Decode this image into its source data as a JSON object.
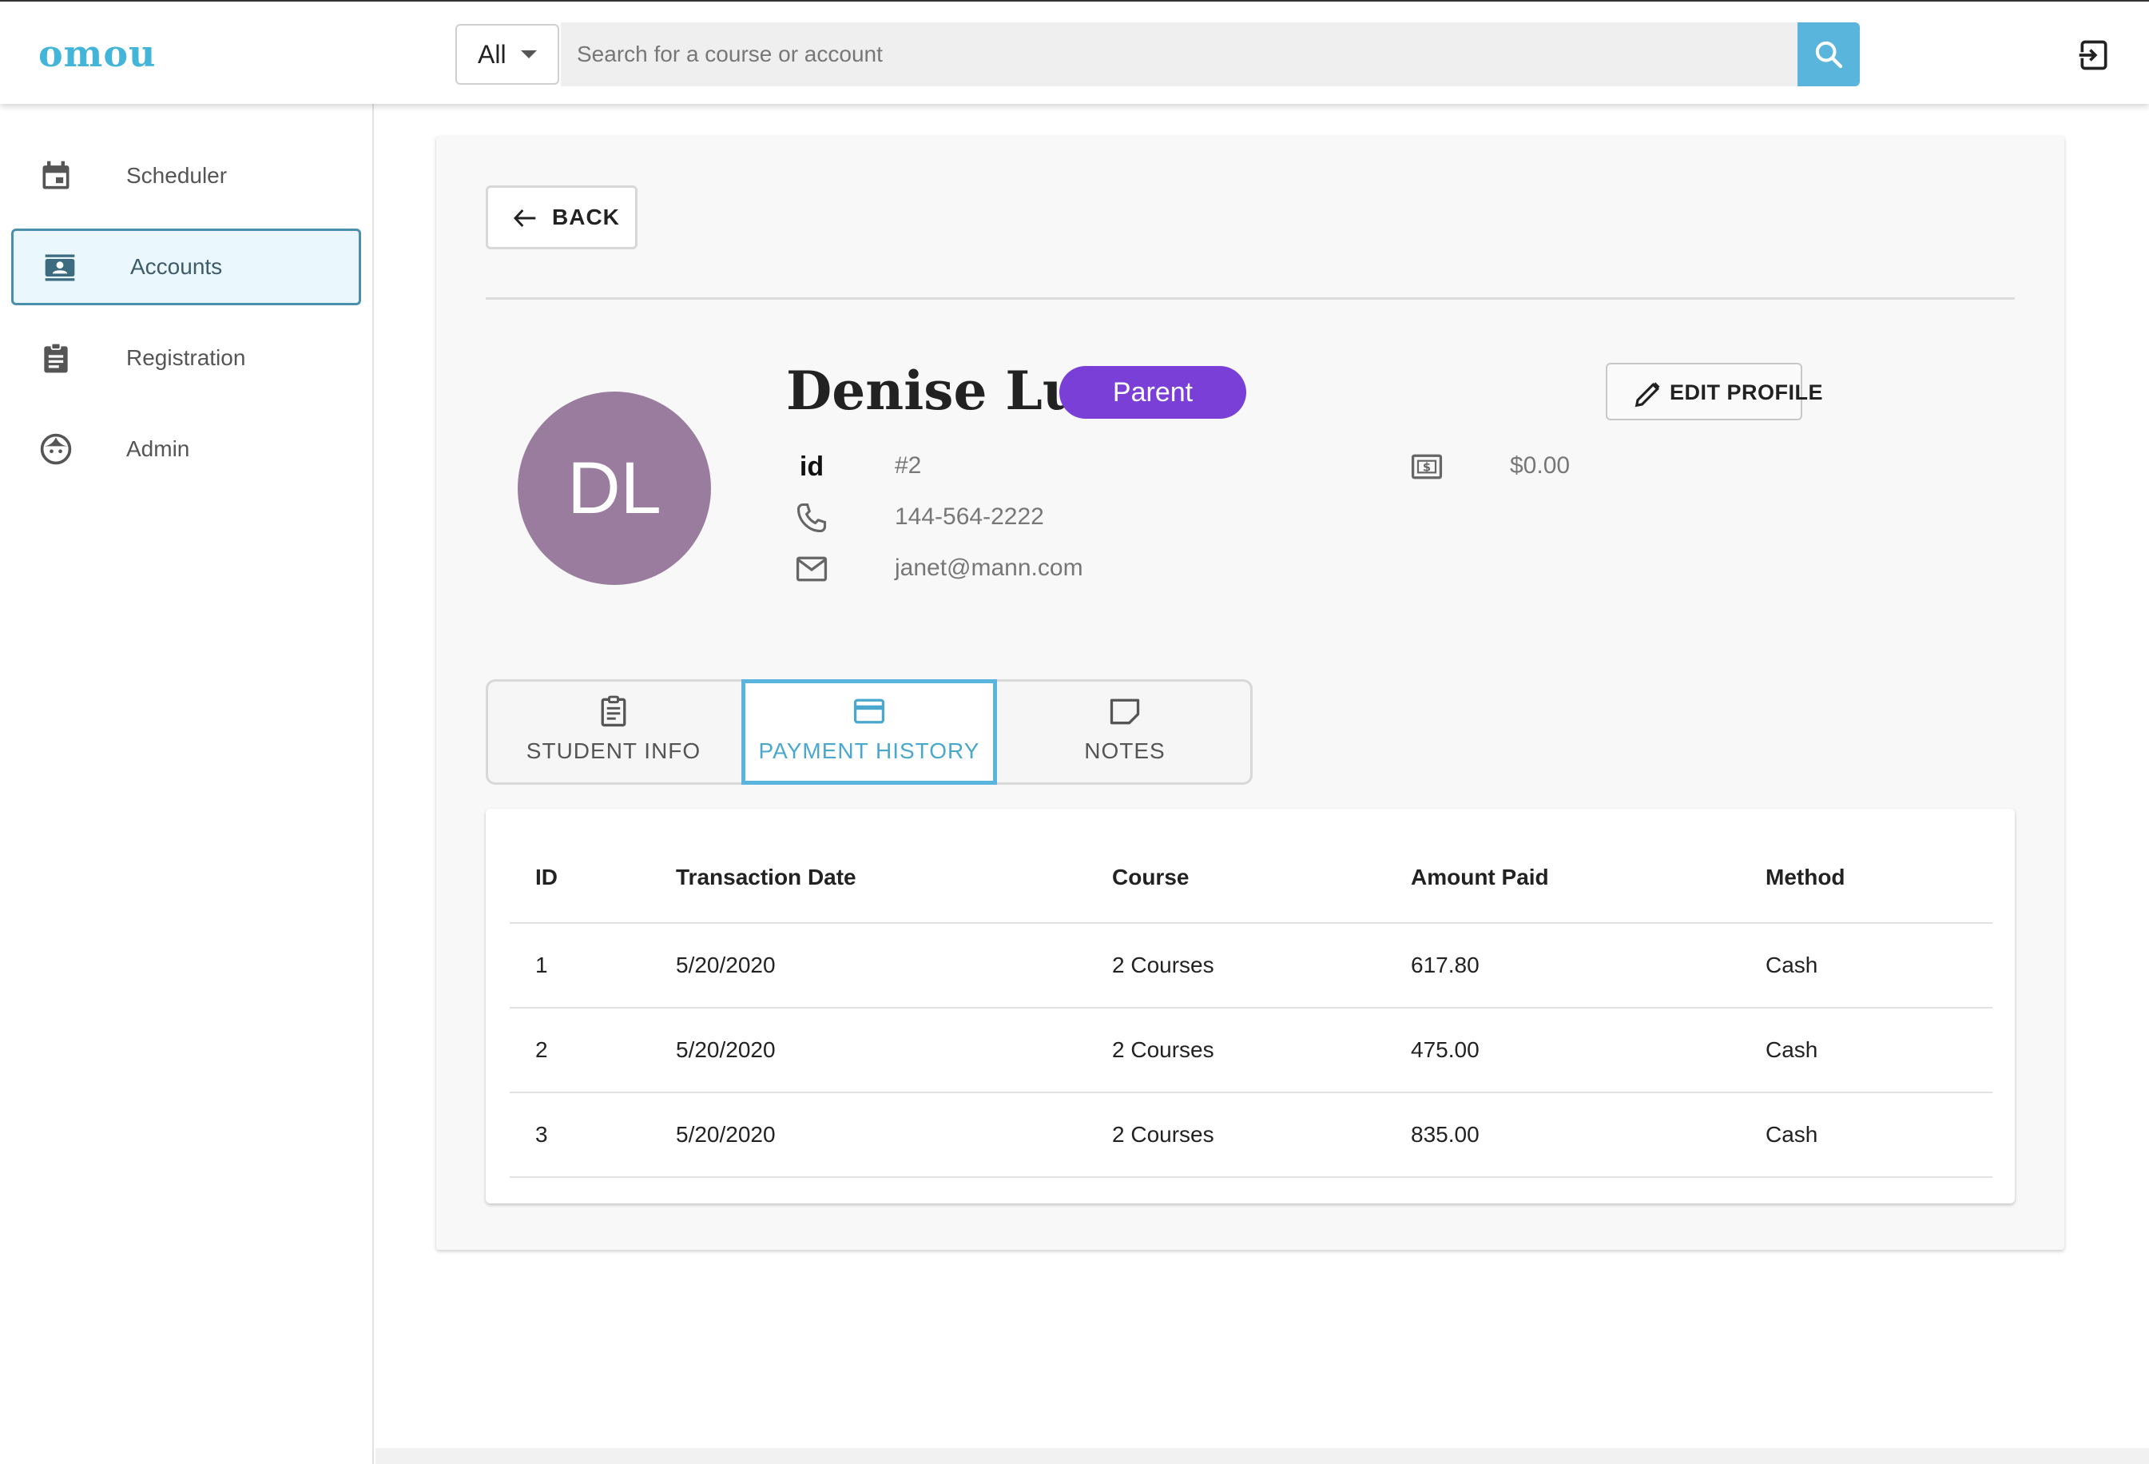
{
  "app": {
    "logo": "omou"
  },
  "search": {
    "type_selected": "All",
    "placeholder": "Search for a course or account"
  },
  "sidebar": {
    "items": [
      {
        "label": "Scheduler",
        "icon": "calendar-icon",
        "active": false
      },
      {
        "label": "Accounts",
        "icon": "contact-card-icon",
        "active": true
      },
      {
        "label": "Registration",
        "icon": "clipboard-icon",
        "active": false
      },
      {
        "label": "Admin",
        "icon": "face-icon",
        "active": false
      }
    ]
  },
  "profile": {
    "back_label": "BACK",
    "name": "Denise Lu",
    "initials": "DL",
    "role": "Parent",
    "edit_label": "EDIT PROFILE",
    "id_label": "id",
    "id_value": "#2",
    "phone": "144-564-2222",
    "email": "janet@mann.com",
    "balance": "$0.00"
  },
  "tabs": [
    {
      "label": "STUDENT INFO",
      "icon": "clipboard-icon",
      "active": false
    },
    {
      "label": "PAYMENT HISTORY",
      "icon": "credit-card-icon",
      "active": true
    },
    {
      "label": "NOTES",
      "icon": "note-icon",
      "active": false
    }
  ],
  "payments": {
    "columns": [
      "ID",
      "Transaction Date",
      "Course",
      "Amount Paid",
      "Method"
    ],
    "rows": [
      [
        "1",
        "5/20/2020",
        "2 Courses",
        "617.80",
        "Cash"
      ],
      [
        "2",
        "5/20/2020",
        "2 Courses",
        "475.00",
        "Cash"
      ],
      [
        "3",
        "5/20/2020",
        "2 Courses",
        "835.00",
        "Cash"
      ]
    ]
  },
  "colors": {
    "accent": "#59b5db",
    "logo": "#43b5d9",
    "role_badge": "#7a3fd6",
    "avatar": "#9a7d9e"
  }
}
